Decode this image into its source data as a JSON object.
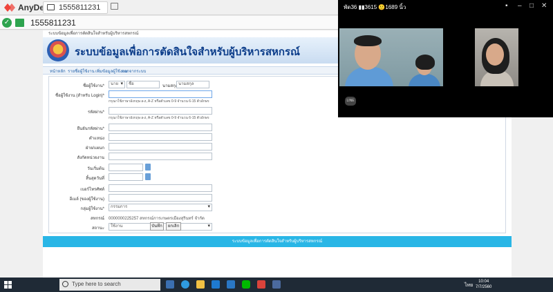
{
  "anydesk": {
    "app_name": "AnyDesk",
    "tab_id": "1555811231",
    "address_id": "1555811231"
  },
  "site": {
    "top_text": "ระบบข้อมูลเพื่อการตัดสินใจสำหรับผู้บริหารสหกรณ์",
    "banner_title": "ระบบข้อมูลเพื่อการตัดสินใจสำหรับผู้บริหารสหกรณ์",
    "nav": [
      "หน้าหลัก",
      "รายชื่อผู้ใช้งาน",
      "เพิ่มข้อมูลผู้ใช้งาน",
      "ออกจากระบบ"
    ],
    "form": {
      "name_label": "ชื่อผู้ใช้งาน*",
      "title_value": "นาย",
      "firstname_placeholder": "ชื่อ",
      "surname_label": "นามสกุล",
      "surname_placeholder": "นามสกุล",
      "username_label": "ชื่อผู้ใช้งาน (สำหรับ Login)*",
      "username_hint": "กรุณาใช้ภาษาอังกฤษ a-z, A-Z หรือตัวเลข 0-9 จำนวน 6-15 ตัวอักษร",
      "password_label": "รหัสผ่าน*",
      "password_hint": "กรุณาใช้ภาษาอังกฤษ a-z, A-Z หรือตัวเลข 0-9 จำนวน 6-15 ตัวอักษร",
      "confirm_label": "ยืนยันรหัสผ่าน*",
      "position_label": "ตำแหน่ง",
      "department_label": "ฝ่าย/แผนก",
      "affiliation_label": "สังกัดหน่วยงาน",
      "start_date_label": "วันเริ่มต้น",
      "end_date_label": "สิ้นสุดวันที่",
      "phone_label": "เบอร์โทรศัพท์",
      "email_label": "อีเมล์ (ของผู้ใช้งาน)",
      "group_label": "กลุ่มผู้ใช้งาน*",
      "group_value": "กรรมการ",
      "coop_label": "สหกรณ์",
      "coop_value": "0000000225257 สหกรณ์การเกษตรเมืองสุรินทร์ จำกัด",
      "status_label": "สถานะ",
      "status_value": "ใช้งาน",
      "save_label": "บันทึก",
      "cancel_label": "ยกเลิก"
    },
    "footer_text": "ระบบข้อมูลเพื่อการตัดสินใจสำหรับผู้บริหารสหกรณ์"
  },
  "call": {
    "status": "พัด36 ▮▮3615 🙂1689 นิ้ว",
    "logo_text": "LINE"
  },
  "taskbar": {
    "search_placeholder": "Type here to search",
    "lang": "ไทย",
    "time": "10:04",
    "date": "7/7/2560"
  }
}
